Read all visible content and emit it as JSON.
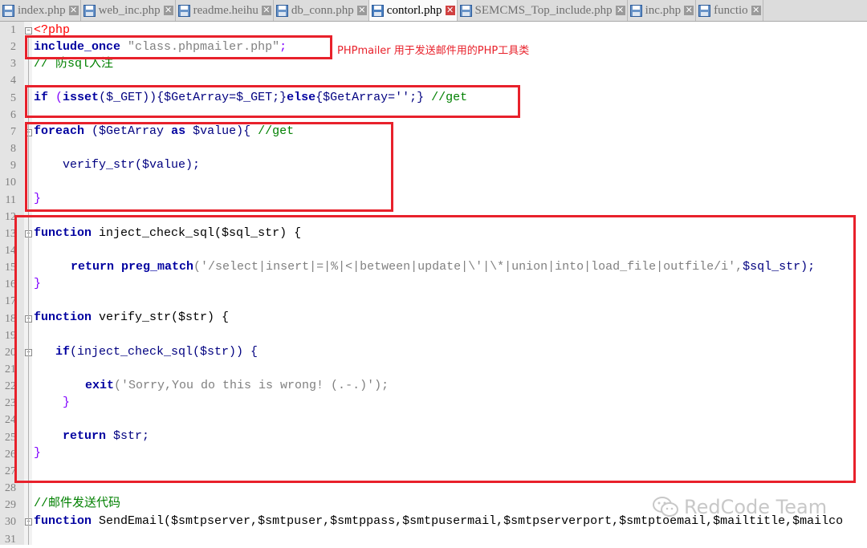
{
  "tabs": [
    {
      "label": "index.php",
      "active": false
    },
    {
      "label": "web_inc.php",
      "active": false
    },
    {
      "label": "readme.heihu",
      "active": false
    },
    {
      "label": "db_conn.php",
      "active": false
    },
    {
      "label": "contorl.php",
      "active": true
    },
    {
      "label": "SEMCMS_Top_include.php",
      "active": false
    },
    {
      "label": "inc.php",
      "active": false
    },
    {
      "label": "functio",
      "active": false
    }
  ],
  "line_numbers": [
    "1",
    "2",
    "3",
    "4",
    "5",
    "6",
    "7",
    "8",
    "9",
    "10",
    "11",
    "12",
    "13",
    "14",
    "15",
    "16",
    "17",
    "18",
    "19",
    "20",
    "21",
    "22",
    "23",
    "24",
    "25",
    "26",
    "27",
    "28",
    "29",
    "30",
    "31"
  ],
  "code": {
    "l1": "<?php",
    "l2_kw": "include_once",
    "l2_str": "\"class.phpmailer.php\"",
    "l3": "// 防sql入注",
    "l5_if": "if",
    "l5_isset": "isset",
    "l5_rest": "($_GET)){$GetArray=$_GET;}",
    "l5_else": "else",
    "l5_rest2": "{$GetArray='';}",
    "l5_cmt": "//get",
    "l7_kw": "foreach",
    "l7_rest": "($GetArray",
    "l7_as": "as",
    "l7_rest2": "$value){",
    "l7_cmt": "//get",
    "l9": "verify_str($value);",
    "l11": "}",
    "l13_kw": "function",
    "l13_rest": "inject_check_sql($sql_str) {",
    "l15_kw": "return",
    "l15_fn": "preg_match",
    "l15_str": "('/select|insert|=|%|<|between|update|\\'|\\*|union|into|load_file|outfile/i',",
    "l15_rest": "$sql_str);",
    "l16": "}",
    "l18_kw": "function",
    "l18_rest": "verify_str($str) {",
    "l20_if": "if",
    "l20_rest": "(inject_check_sql($str)) {",
    "l22_kw": "exit",
    "l22_str": "('Sorry,You do this is wrong! (.-.)');",
    "l23": "}",
    "l25_kw": "return",
    "l25_rest": "$str;",
    "l26": "}",
    "l29": "//邮件发送代码",
    "l30_kw": "function",
    "l30_rest": "SendEmail($smtpserver,$smtpuser,$smtppass,$smtpusermail,$smtpserverport,$smtptoemail,$mailtitle,$mailco"
  },
  "annotation": "PHPmailer 用于发送邮件用的PHP工具类",
  "watermark": "RedCode Team",
  "colors": {
    "highlight": "#e8212b",
    "keyword": "#0000a0",
    "comment": "#008000",
    "string": "#808080"
  }
}
